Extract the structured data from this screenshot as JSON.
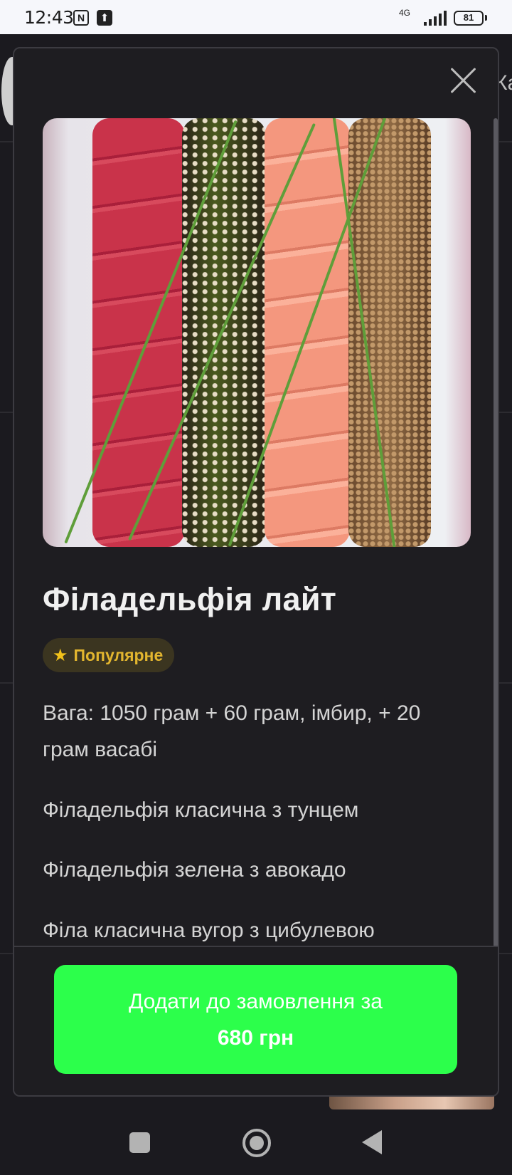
{
  "status_bar": {
    "time": "12:43",
    "network": "4G",
    "battery": "81",
    "icons": [
      "nfc-icon",
      "upload-icon",
      "signal-icon",
      "battery-icon"
    ]
  },
  "background": {
    "right_text": "Ка"
  },
  "modal": {
    "close_icon": "close-icon",
    "product": {
      "title": "Філадельфія лайт",
      "badge": {
        "icon": "star-icon",
        "label": "Популярне"
      },
      "description": [
        "Вага: 1050 грам + 60 грам, імбир, + 20 грам васабі",
        "Філадельфія класична з тунцем",
        "Філадельфія зелена з авокадо",
        "Філа класична вугор з цибулевою"
      ]
    },
    "order_button": {
      "label": "Додати до замовлення за",
      "price": "680 грн"
    },
    "colors": {
      "accent": "#2cff4b",
      "badge_text": "#e3b62f",
      "badge_bg": "#3b3520"
    }
  },
  "nav_bar": {
    "icons": [
      "recent-apps-icon",
      "home-icon",
      "back-icon"
    ]
  }
}
